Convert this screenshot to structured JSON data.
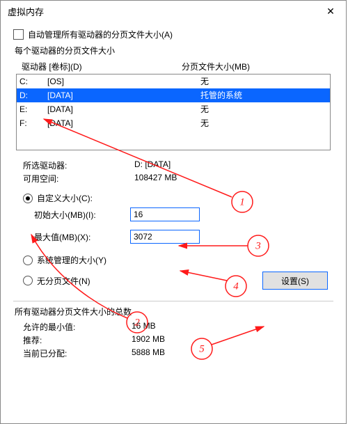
{
  "window": {
    "title": "虚拟内存",
    "close_glyph": "✕"
  },
  "auto_manage": {
    "label": "自动管理所有驱动器的分页文件大小(A)"
  },
  "per_drive": {
    "label": "每个驱动器的分页文件大小",
    "header_name": "驱动器 [卷标](D)",
    "header_size": "分页文件大小(MB)",
    "rows": [
      {
        "letter": "C:",
        "label": "[OS]",
        "size": "无"
      },
      {
        "letter": "D:",
        "label": "[DATA]",
        "size": "托管的系统"
      },
      {
        "letter": "E:",
        "label": "[DATA]",
        "size": "无"
      },
      {
        "letter": "F:",
        "label": "[DATA]",
        "size": "无"
      }
    ],
    "selected_index": 1
  },
  "selected": {
    "drive_label": "所选驱动器:",
    "drive_value": "D:  [DATA]",
    "free_label": "可用空间:",
    "free_value": "108427 MB"
  },
  "custom": {
    "radio_label": "自定义大小(C):",
    "initial_label": "初始大小(MB)(I):",
    "initial_value": "16",
    "max_label": "最大值(MB)(X):",
    "max_value": "3072"
  },
  "system_managed": {
    "label": "系统管理的大小(Y)"
  },
  "no_pagefile": {
    "label": "无分页文件(N)"
  },
  "set_button": "设置(S)",
  "totals": {
    "heading": "所有驱动器分页文件大小的总数",
    "min_label": "允许的最小值:",
    "min_value": "16 MB",
    "rec_label": "推荐:",
    "rec_value": "1902 MB",
    "cur_label": "当前已分配:",
    "cur_value": "5888 MB"
  },
  "annotations": [
    "1",
    "2",
    "3",
    "4",
    "5"
  ]
}
